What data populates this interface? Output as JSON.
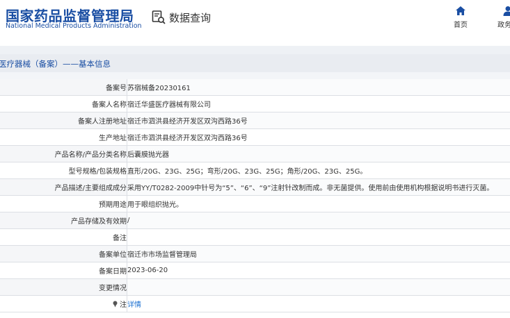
{
  "header": {
    "logo_cn": "国家药品监督管理局",
    "logo_en": "National Medical Products Administration",
    "data_query": "数据查询",
    "nav": [
      {
        "label": "首页"
      },
      {
        "label": "政务服"
      }
    ]
  },
  "breadcrumb": "医疗器械（备案）——基本信息",
  "rows": [
    {
      "label": "备案号",
      "value": "苏宿械备20230161"
    },
    {
      "label": "备案人名称",
      "value": "宿迁华盛医疗器械有限公司"
    },
    {
      "label": "备案人注册地址",
      "value": "宿迁市泗洪县经济开发区双沟西路36号"
    },
    {
      "label": "生产地址",
      "value": "宿迁市泗洪县经济开发区双沟西路36号"
    },
    {
      "label": "产品名称/产品分类名称",
      "value": "后囊膜抛光器"
    },
    {
      "label": "型号规格/包装规格",
      "value": "直形/20G、23G、25G；弯形/20G、23G、25G；角形/20G、23G、25G。"
    },
    {
      "label": "产品描述/主要组成成分",
      "value": "采用YY/T0282-2009中针号为“5”、“6”、“9”注射针改制而成。非无菌提供。使用前由使用机构根据说明书进行灭菌。"
    },
    {
      "label": "预期用途",
      "value": "用于眼组织抛光。"
    },
    {
      "label": "产品存储及有效期",
      "value": "/"
    },
    {
      "label": "备注",
      "value": ""
    },
    {
      "label": "备案单位",
      "value": "宿迁市市场监督管理局"
    },
    {
      "label": "备案日期",
      "value": "2023-06-20"
    },
    {
      "label": "变更情况",
      "value": ""
    },
    {
      "label": "注",
      "value": "详情"
    }
  ],
  "colors": {
    "brand_blue": "#1a4ea3",
    "link_blue": "#1a6fd0"
  },
  "icons": {
    "data_query": "document-search-icon",
    "home": "home-icon",
    "gov_service": "user-icon",
    "note": "pin-icon"
  }
}
